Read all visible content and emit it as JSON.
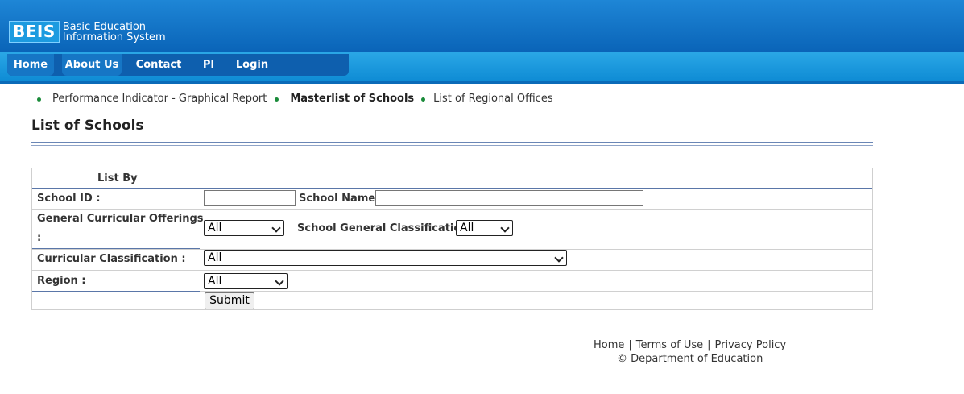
{
  "logo": {
    "mark": "BEIS",
    "line1": "Basic Education",
    "line2": "Information System"
  },
  "nav": {
    "items": [
      "Home",
      "About Us",
      "Contact",
      "PI",
      "Login"
    ]
  },
  "links": [
    "Performance Indicator - Graphical Report",
    "Masterlist of Schools",
    "List of Regional Offices"
  ],
  "page_title": "List of Schools",
  "form": {
    "list_by": "List By",
    "school_id_label": "School ID :",
    "school_id_value": "",
    "school_name_label": "School Name :",
    "school_name_value": "",
    "gco_label_line1": "General Curricular Offerings",
    "gco_label_line2": ":",
    "gco_value": "All",
    "sgc_label": "School General Classification :",
    "sgc_value": "All",
    "cc_label": "Curricular Classification :",
    "cc_value": "All",
    "region_label": "Region :",
    "region_value": "All",
    "submit": "Submit"
  },
  "footer": {
    "home": "Home",
    "terms": "Terms of Use",
    "privacy": "Privacy Policy",
    "sep": "|",
    "copyright": "© Department of Education"
  }
}
